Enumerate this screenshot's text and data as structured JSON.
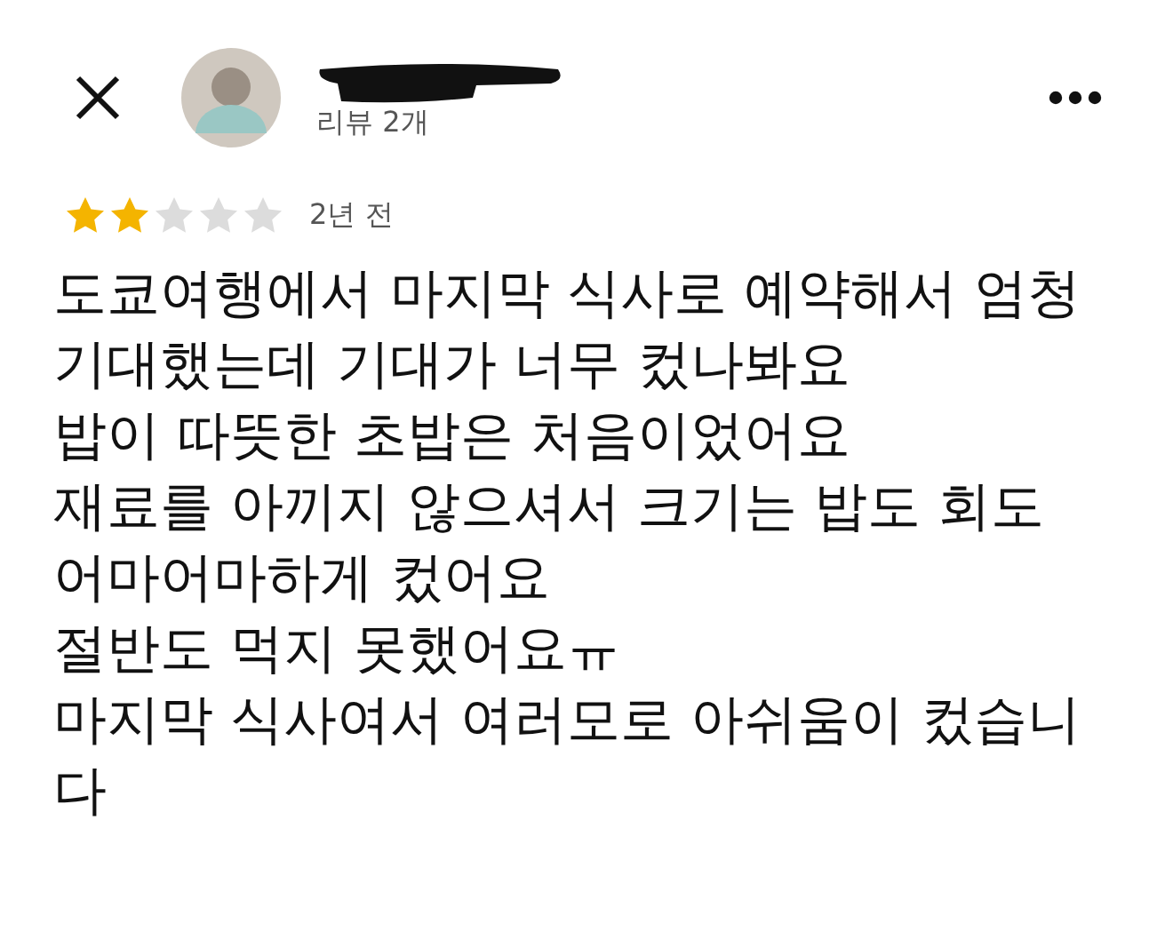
{
  "header": {
    "review_count": "리뷰 2개",
    "name_redacted": true
  },
  "rating": {
    "stars": 2,
    "date": "2년 전"
  },
  "review_text": "도쿄여행에서 마지막 식사로 예약해서 엄청\n기대했는데 기대가 너무 컸나봐요\n밥이 따뜻한 초밥은 처음이었어요\n재료를 아끼지 않으셔서 크기는 밥도 회도\n어마어마하게 컸어요\n절반도 먹지 못했어요ㅠ\n마지막 식사여서 여러모로 아쉬움이 컸습니\n다"
}
